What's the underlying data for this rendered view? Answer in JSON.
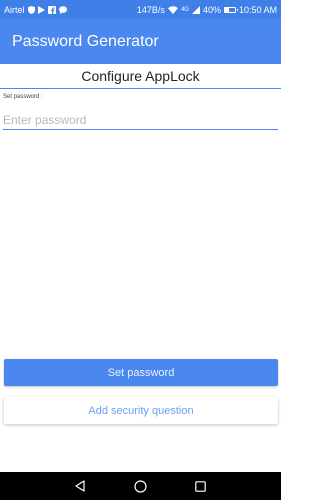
{
  "status_bar": {
    "carrier": "Airtel",
    "network_speed": "147B/s",
    "signal_type": "4G",
    "battery_percent": "40%",
    "battery_level": 0.4,
    "time": "10:50 AM",
    "icons": [
      "shield-icon",
      "flag-icon",
      "facebook-icon",
      "chat-icon",
      "wifi-icon",
      "signal-icon",
      "battery-icon"
    ]
  },
  "app_bar": {
    "title": "Password Generator"
  },
  "configure": {
    "title": "Configure AppLock",
    "field_label": "Set password :",
    "password_placeholder": "Enter password",
    "password_value": ""
  },
  "buttons": {
    "set_password": "Set password",
    "add_security_question": "Add security question"
  },
  "nav_bar": {
    "icons": [
      "back-icon",
      "home-icon",
      "recents-icon"
    ]
  },
  "colors": {
    "status_bar": "#3f7fe8",
    "accent": "#4a87ee",
    "secondary_text": "#6a9ff0",
    "nav_bar": "#000000"
  }
}
